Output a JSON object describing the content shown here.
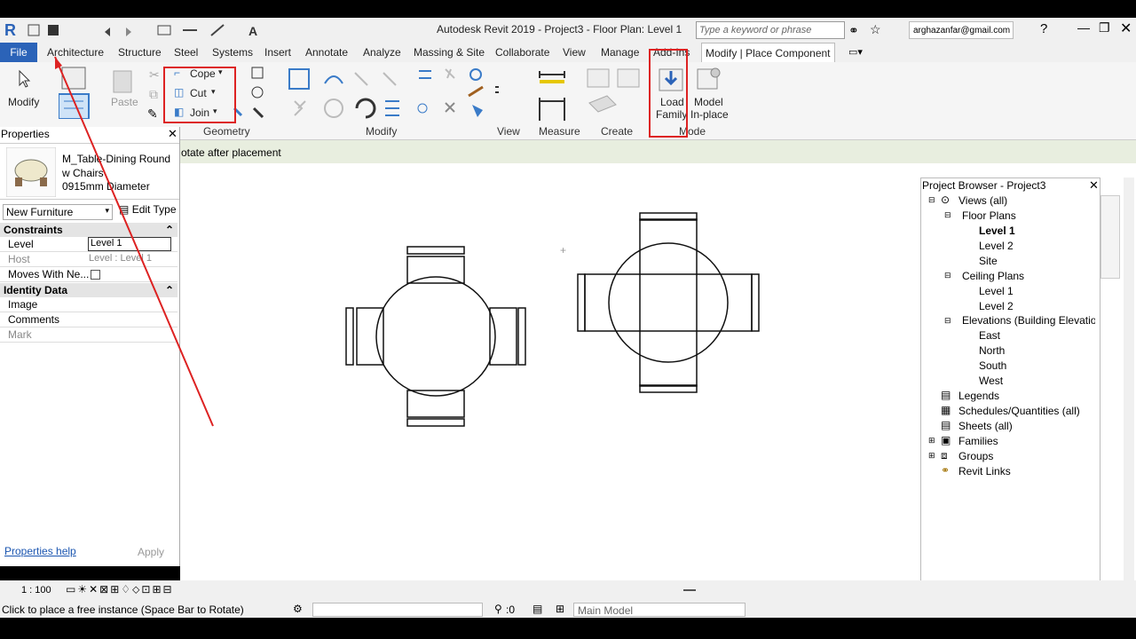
{
  "titlebar": {
    "app_title": "Autodesk Revit 2019 - Project3 - Floor Plan: Level 1",
    "search_placeholder": "Type a keyword or phrase",
    "user": "arghazanfar@gmail.com"
  },
  "tabs": {
    "file": "File",
    "architecture": "Architecture",
    "structure": "Structure",
    "steel": "Steel",
    "systems": "Systems",
    "insert": "Insert",
    "annotate": "Annotate",
    "analyze": "Analyze",
    "massing": "Massing & Site",
    "collaborate": "Collaborate",
    "view": "View",
    "manage": "Manage",
    "addins": "Add-Ins",
    "context": "Modify | Place Component"
  },
  "ribbon": {
    "modify": "Modify",
    "paste": "Paste",
    "cope": "Cope",
    "cut": "Cut",
    "join": "Join",
    "load_family_1": "Load",
    "load_family_2": "Family",
    "model_inplace_1": "Model",
    "model_inplace_2": "In-place",
    "panels": {
      "geometry": "Geometry",
      "modify": "Modify",
      "view": "View",
      "measure": "Measure",
      "create": "Create",
      "mode": "Mode"
    }
  },
  "options_bar": {
    "rotate_text": "otate after placement"
  },
  "properties": {
    "title": "Properties",
    "family_line1": "M_Table-Dining Round",
    "family_line2": "w Chairs",
    "family_line3": "0915mm Diameter",
    "type_selector": "New Furniture",
    "edit_type": "Edit Type",
    "constraints": "Constraints",
    "level_label": "Level",
    "level_value": "Level 1",
    "host_label": "Host",
    "host_value": "Level : Level 1",
    "moves_label": "Moves With Ne...",
    "identity": "Identity Data",
    "image_label": "Image",
    "comments_label": "Comments",
    "mark_label": "Mark",
    "help": "Properties help",
    "apply": "Apply"
  },
  "browser": {
    "title": "Project Browser - Project3",
    "views_all": "Views (all)",
    "floor_plans": "Floor Plans",
    "fp_level1": "Level 1",
    "fp_level2": "Level 2",
    "fp_site": "Site",
    "ceiling_plans": "Ceiling Plans",
    "cp_level1": "Level 1",
    "cp_level2": "Level 2",
    "elevations": "Elevations (Building Elevation)",
    "east": "East",
    "north": "North",
    "south": "South",
    "west": "West",
    "legends": "Legends",
    "schedules": "Schedules/Quantities (all)",
    "sheets": "Sheets (all)",
    "families": "Families",
    "groups": "Groups",
    "revit_links": "Revit Links"
  },
  "status": {
    "scale": "1 : 100",
    "message": "Click to place a free instance (Space Bar to Rotate)",
    "count": ":0",
    "model": "Main Model"
  }
}
